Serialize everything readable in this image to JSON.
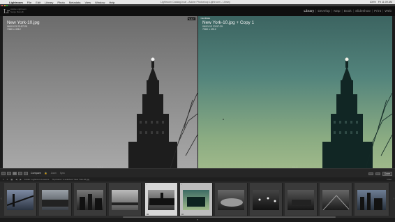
{
  "menubar": {
    "apple": "",
    "items": [
      "Lightroom",
      "File",
      "Edit",
      "Library",
      "Photo",
      "Metadata",
      "View",
      "Window",
      "Help"
    ],
    "window_title": "Lightroom Catalog.lrcat - Adobe Photoshop Lightroom - Library",
    "status": [
      "100%",
      "Fri 11:09 AM"
    ]
  },
  "identity": {
    "logo": "Lr",
    "line1": "Adobe Lightroom",
    "line2": "Serge Ramelli"
  },
  "modules": {
    "items": [
      {
        "label": "Library",
        "active": true
      },
      {
        "label": "Develop",
        "active": false
      },
      {
        "label": "Map",
        "active": false
      },
      {
        "label": "Book",
        "active": false
      },
      {
        "label": "Slideshow",
        "active": false
      },
      {
        "label": "Print",
        "active": false
      },
      {
        "label": "Web",
        "active": false
      }
    ]
  },
  "compare": {
    "left": {
      "tag": "Select",
      "filename": "New York-10.jpg",
      "date": "06/01/13 23:57:29",
      "dimensions": "7360 x 4912"
    },
    "right": {
      "tag": "Candidate",
      "filename": "New York-10.jpg + Copy 1",
      "date": "06/01/13 23:57:29",
      "dimensions": "7360 x 4912"
    }
  },
  "toolbar": {
    "view_label": "Compare",
    "zoom_label": "Zoom",
    "sync_label": "Sync",
    "done_label": "Done"
  },
  "filmstrip_bar": {
    "page_1": "1",
    "page_2": "2",
    "source": "Folder: Lightroom Lessons",
    "count": "79 photos / 2 selected / New York-10.jpg",
    "filter": "Filter:"
  },
  "colors": {
    "module_active": "#e8e8e8",
    "module_inactive": "#8a8a8a",
    "left_tint": "#8a8a8a",
    "right_tint": "#53847c",
    "selected_thumb": "#d7d7d7"
  }
}
